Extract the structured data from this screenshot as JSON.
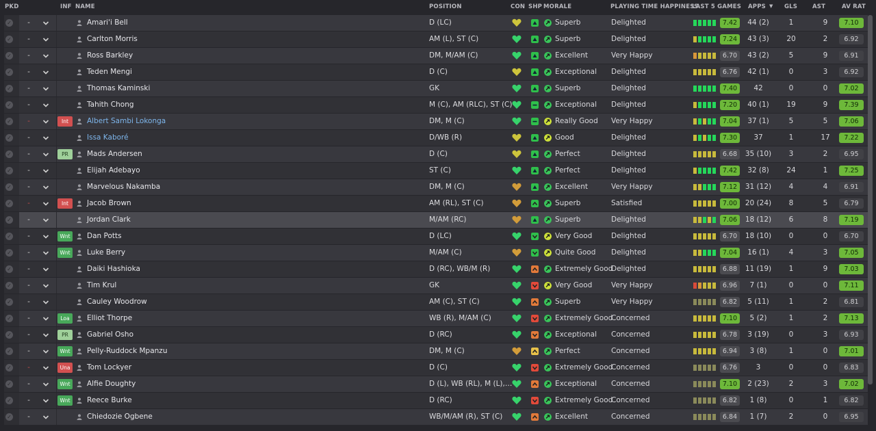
{
  "headers": {
    "pkd": "PKD",
    "inf": "INF",
    "name": "NAME",
    "position": "POSITION",
    "con": "CON",
    "shp": "SHP",
    "morale": "MORALE",
    "pth": "PLAYING TIME HAPPINESS",
    "l5": "LAST 5 GAMES",
    "apps": "APPS",
    "gls": "GLS",
    "ast": "AST",
    "avr": "AV RAT"
  },
  "colors": {
    "bar_green": "#25d85a",
    "bar_yellow": "#c8ba3c",
    "bar_orange": "#d8963a",
    "bar_red": "#d84a3a",
    "bar_grey": "#8a8a5a",
    "con_green": "#37d36b",
    "con_yellow": "#cdc43c",
    "con_orange": "#d29c3a",
    "shp_green": "#2fbf4b",
    "shp_orange": "#e27a3a",
    "shp_red": "#e24a3a",
    "shp_yellow": "#e8c24a",
    "mor_green": "#39c45a",
    "mor_yellow": "#cde03a"
  },
  "players": [
    {
      "inf": "",
      "inf_color": "",
      "name": "Amari'i Bell",
      "link": false,
      "pos": "D (LC)",
      "con": "yellow",
      "shp": "green",
      "shp_icon": "up",
      "mor_icon": "green",
      "mor": "Superb",
      "pth": "Delighted",
      "l5": [
        "g",
        "g",
        "g",
        "g",
        "g"
      ],
      "l5val": "7.42",
      "l5green": true,
      "apps": "44 (2)",
      "gls": "1",
      "ast": "9",
      "avr": "7.10",
      "avrgreen": true,
      "dash": "-",
      "dash_red": false
    },
    {
      "inf": "",
      "inf_color": "",
      "name": "Carlton Morris",
      "link": false,
      "pos": "AM (L), ST (C)",
      "con": "green",
      "shp": "green",
      "shp_icon": "up",
      "mor_icon": "green",
      "mor": "Superb",
      "pth": "Delighted",
      "l5": [
        "y",
        "g",
        "g",
        "g",
        "g"
      ],
      "l5val": "7.24",
      "l5green": true,
      "apps": "43 (3)",
      "gls": "20",
      "ast": "2",
      "avr": "6.92",
      "avrgreen": false,
      "dash": "-",
      "dash_red": false
    },
    {
      "inf": "",
      "inf_color": "",
      "name": "Ross Barkley",
      "link": false,
      "pos": "DM, M/AM (C)",
      "con": "green",
      "shp": "green",
      "shp_icon": "up",
      "mor_icon": "green",
      "mor": "Excellent",
      "pth": "Very Happy",
      "l5": [
        "o",
        "y",
        "y",
        "y",
        "y"
      ],
      "l5val": "6.70",
      "l5green": false,
      "apps": "43 (2)",
      "gls": "5",
      "ast": "9",
      "avr": "6.91",
      "avrgreen": false,
      "dash": "-",
      "dash_red": false
    },
    {
      "inf": "",
      "inf_color": "",
      "name": "Teden Mengi",
      "link": false,
      "pos": "D (C)",
      "con": "yellow",
      "shp": "green",
      "shp_icon": "up",
      "mor_icon": "green",
      "mor": "Exceptional",
      "pth": "Delighted",
      "l5": [
        "y",
        "y",
        "y",
        "y",
        "y"
      ],
      "l5val": "6.76",
      "l5green": false,
      "apps": "42 (1)",
      "gls": "0",
      "ast": "3",
      "avr": "6.92",
      "avrgreen": false,
      "dash": "-",
      "dash_red": false
    },
    {
      "inf": "",
      "inf_color": "",
      "name": "Thomas Kaminski",
      "link": false,
      "pos": "GK",
      "con": "green",
      "shp": "green",
      "shp_icon": "up",
      "mor_icon": "green",
      "mor": "Superb",
      "pth": "Delighted",
      "l5": [
        "g",
        "g",
        "g",
        "g",
        "g"
      ],
      "l5val": "7.40",
      "l5green": true,
      "apps": "42",
      "gls": "0",
      "ast": "0",
      "avr": "7.02",
      "avrgreen": true,
      "dash": "-",
      "dash_red": false
    },
    {
      "inf": "",
      "inf_color": "",
      "name": "Tahith Chong",
      "link": false,
      "pos": "M (C), AM (RLC), ST (C)",
      "con": "green",
      "shp": "green",
      "shp_icon": "flat",
      "mor_icon": "green",
      "mor": "Exceptional",
      "pth": "Delighted",
      "l5": [
        "y",
        "g",
        "g",
        "g",
        "g"
      ],
      "l5val": "7.20",
      "l5green": true,
      "apps": "40 (1)",
      "gls": "19",
      "ast": "9",
      "avr": "7.39",
      "avrgreen": true,
      "dash": "-",
      "dash_red": false
    },
    {
      "inf": "Int",
      "inf_color": "red",
      "name": "Albert Sambi Lokonga",
      "link": true,
      "pos": "DM, M (C)",
      "con": "green",
      "shp": "green",
      "shp_icon": "flat",
      "mor_icon": "yellow",
      "mor": "Really Good",
      "pth": "Very Happy",
      "l5": [
        "y",
        "g",
        "y",
        "g",
        "g"
      ],
      "l5val": "7.04",
      "l5green": true,
      "apps": "37 (1)",
      "gls": "5",
      "ast": "5",
      "avr": "7.06",
      "avrgreen": true,
      "dash": "-",
      "dash_red": true
    },
    {
      "inf": "",
      "inf_color": "",
      "name": "Issa Kaboré",
      "link": true,
      "pos": "D/WB (R)",
      "con": "yellow",
      "shp": "green",
      "shp_icon": "up",
      "mor_icon": "yellow",
      "mor": "Good",
      "pth": "Delighted",
      "l5": [
        "y",
        "g",
        "y",
        "g",
        "g"
      ],
      "l5val": "7.30",
      "l5green": true,
      "apps": "37",
      "gls": "1",
      "ast": "17",
      "avr": "7.22",
      "avrgreen": true,
      "dash": "-",
      "dash_red": false
    },
    {
      "inf": "PR",
      "inf_color": "lgreen",
      "name": "Mads Andersen",
      "link": false,
      "pos": "D (C)",
      "con": "yellow",
      "shp": "green",
      "shp_icon": "up",
      "mor_icon": "green",
      "mor": "Perfect",
      "pth": "Delighted",
      "l5": [
        "y",
        "y",
        "y",
        "y",
        "y"
      ],
      "l5val": "6.68",
      "l5green": false,
      "apps": "35 (10)",
      "gls": "3",
      "ast": "2",
      "avr": "6.95",
      "avrgreen": false,
      "dash": "-",
      "dash_red": false
    },
    {
      "inf": "",
      "inf_color": "",
      "name": "Elijah Adebayo",
      "link": false,
      "pos": "ST (C)",
      "con": "green",
      "shp": "green",
      "shp_icon": "up",
      "mor_icon": "green",
      "mor": "Perfect",
      "pth": "Delighted",
      "l5": [
        "y",
        "g",
        "g",
        "g",
        "g"
      ],
      "l5val": "7.42",
      "l5green": true,
      "apps": "32 (8)",
      "gls": "24",
      "ast": "1",
      "avr": "7.25",
      "avrgreen": true,
      "dash": "-",
      "dash_red": false
    },
    {
      "inf": "",
      "inf_color": "",
      "name": "Marvelous Nakamba",
      "link": false,
      "pos": "DM, M (C)",
      "con": "orange",
      "shp": "green",
      "shp_icon": "up",
      "mor_icon": "green",
      "mor": "Excellent",
      "pth": "Very Happy",
      "l5": [
        "y",
        "y",
        "g",
        "g",
        "g"
      ],
      "l5val": "7.12",
      "l5green": true,
      "apps": "31 (12)",
      "gls": "4",
      "ast": "4",
      "avr": "6.91",
      "avrgreen": false,
      "dash": "-",
      "dash_red": false
    },
    {
      "inf": "Int",
      "inf_color": "red",
      "name": "Jacob Brown",
      "link": false,
      "pos": "AM (RL), ST (C)",
      "con": "orange",
      "shp": "green",
      "shp_icon": "chev",
      "mor_icon": "green",
      "mor": "Superb",
      "pth": "Satisfied",
      "l5": [
        "y",
        "y",
        "y",
        "y",
        "y"
      ],
      "l5val": "7.00",
      "l5green": true,
      "apps": "20 (24)",
      "gls": "8",
      "ast": "5",
      "avr": "6.79",
      "avrgreen": false,
      "dash": "-",
      "dash_red": true
    },
    {
      "inf": "",
      "inf_color": "",
      "name": "Jordan Clark",
      "link": false,
      "pos": "M/AM (RC)",
      "con": "orange",
      "shp": "green",
      "shp_icon": "up",
      "mor_icon": "green",
      "mor": "Superb",
      "pth": "Delighted",
      "l5": [
        "y",
        "y",
        "g",
        "y",
        "g"
      ],
      "l5val": "7.06",
      "l5green": true,
      "apps": "18 (12)",
      "gls": "6",
      "ast": "8",
      "avr": "7.19",
      "avrgreen": true,
      "dash": "-",
      "dash_red": false,
      "hl": true
    },
    {
      "inf": "Wnt",
      "inf_color": "green",
      "name": "Dan Potts",
      "link": false,
      "pos": "D (LC)",
      "con": "green",
      "shp": "green",
      "shp_icon": "down",
      "mor_icon": "yellow",
      "mor": "Very Good",
      "pth": "Delighted",
      "l5": [
        "y",
        "y",
        "y",
        "y",
        "y"
      ],
      "l5val": "6.70",
      "l5green": false,
      "apps": "18 (10)",
      "gls": "0",
      "ast": "0",
      "avr": "6.70",
      "avrgreen": false,
      "dash": "-",
      "dash_red": false
    },
    {
      "inf": "Wnt",
      "inf_color": "green",
      "name": "Luke Berry",
      "link": false,
      "pos": "M/AM (C)",
      "con": "orange",
      "shp": "green",
      "shp_icon": "down",
      "mor_icon": "yellow",
      "mor": "Quite Good",
      "pth": "Delighted",
      "l5": [
        "y",
        "y",
        "g",
        "g",
        "g"
      ],
      "l5val": "7.04",
      "l5green": true,
      "apps": "16 (1)",
      "gls": "4",
      "ast": "3",
      "avr": "7.05",
      "avrgreen": true,
      "dash": "-",
      "dash_red": false
    },
    {
      "inf": "",
      "inf_color": "",
      "name": "Daiki Hashioka",
      "link": false,
      "pos": "D (RC), WB/M (R)",
      "con": "green",
      "shp": "orange",
      "shp_icon": "chev",
      "mor_icon": "green",
      "mor": "Extremely Good",
      "pth": "Delighted",
      "l5": [
        "y",
        "y",
        "y",
        "y",
        "y"
      ],
      "l5val": "6.88",
      "l5green": false,
      "apps": "11 (19)",
      "gls": "1",
      "ast": "9",
      "avr": "7.03",
      "avrgreen": true,
      "dash": "-",
      "dash_red": false
    },
    {
      "inf": "",
      "inf_color": "",
      "name": "Tim Krul",
      "link": false,
      "pos": "GK",
      "con": "green",
      "shp": "red",
      "shp_icon": "down",
      "mor_icon": "yellow",
      "mor": "Very Good",
      "pth": "Very Happy",
      "l5": [
        "r",
        "o",
        "y",
        "y",
        "y"
      ],
      "l5val": "6.96",
      "l5green": false,
      "apps": "7 (1)",
      "gls": "0",
      "ast": "0",
      "avr": "7.11",
      "avrgreen": true,
      "dash": "-",
      "dash_red": false
    },
    {
      "inf": "",
      "inf_color": "",
      "name": "Cauley Woodrow",
      "link": false,
      "pos": "AM (C), ST (C)",
      "con": "green",
      "shp": "orange",
      "shp_icon": "chev",
      "mor_icon": "green",
      "mor": "Superb",
      "pth": "Very Happy",
      "l5": [
        "n",
        "n",
        "n",
        "n",
        "n"
      ],
      "l5val": "6.82",
      "l5green": false,
      "apps": "5 (11)",
      "gls": "1",
      "ast": "2",
      "avr": "6.81",
      "avrgreen": false,
      "dash": "-",
      "dash_red": false
    },
    {
      "inf": "Loa",
      "inf_color": "green",
      "name": "Elliot Thorpe",
      "link": false,
      "pos": "WB (R), M/AM (C)",
      "con": "green",
      "shp": "red",
      "shp_icon": "down",
      "mor_icon": "green",
      "mor": "Extremely Good",
      "pth": "Concerned",
      "l5": [
        "y",
        "y",
        "y",
        "y",
        "y"
      ],
      "l5val": "7.10",
      "l5green": true,
      "apps": "5 (2)",
      "gls": "1",
      "ast": "2",
      "avr": "7.13",
      "avrgreen": true,
      "dash": "-",
      "dash_red": false
    },
    {
      "inf": "PR",
      "inf_color": "lgreen",
      "name": "Gabriel Osho",
      "link": false,
      "pos": "D (RC)",
      "con": "green",
      "shp": "orange",
      "shp_icon": "down",
      "mor_icon": "green",
      "mor": "Exceptional",
      "pth": "Concerned",
      "l5": [
        "y",
        "y",
        "y",
        "y",
        "y"
      ],
      "l5val": "6.78",
      "l5green": false,
      "apps": "3 (19)",
      "gls": "0",
      "ast": "3",
      "avr": "6.93",
      "avrgreen": false,
      "dash": "-",
      "dash_red": false
    },
    {
      "inf": "Wnt",
      "inf_color": "green",
      "name": "Pelly-Ruddock Mpanzu",
      "link": false,
      "pos": "DM, M (C)",
      "con": "orange",
      "shp": "yellow",
      "shp_icon": "chev",
      "mor_icon": "green",
      "mor": "Perfect",
      "pth": "Concerned",
      "l5": [
        "y",
        "y",
        "y",
        "y",
        "y"
      ],
      "l5val": "6.94",
      "l5green": false,
      "apps": "3 (8)",
      "gls": "1",
      "ast": "0",
      "avr": "7.01",
      "avrgreen": true,
      "dash": "-",
      "dash_red": false
    },
    {
      "inf": "Una",
      "inf_color": "red",
      "name": "Tom Lockyer",
      "link": false,
      "pos": "D (C)",
      "con": "green",
      "shp": "red",
      "shp_icon": "down",
      "mor_icon": "green",
      "mor": "Extremely Good",
      "pth": "Concerned",
      "l5": [
        "n",
        "n",
        "n",
        "n",
        "n"
      ],
      "l5val": "6.76",
      "l5green": false,
      "apps": "3",
      "gls": "0",
      "ast": "0",
      "avr": "6.83",
      "avrgreen": false,
      "dash": "-",
      "dash_red": true
    },
    {
      "inf": "Wnt",
      "inf_color": "green",
      "name": "Alfie Doughty",
      "link": false,
      "pos": "D (L), WB (RL), M (L),…",
      "con": "green",
      "shp": "orange",
      "shp_icon": "chev",
      "mor_icon": "green",
      "mor": "Exceptional",
      "pth": "Concerned",
      "l5": [
        "n",
        "n",
        "n",
        "n",
        "n"
      ],
      "l5val": "7.10",
      "l5green": true,
      "apps": "2 (23)",
      "gls": "2",
      "ast": "3",
      "avr": "7.02",
      "avrgreen": true,
      "dash": "-",
      "dash_red": false
    },
    {
      "inf": "Wnt",
      "inf_color": "green",
      "name": "Reece Burke",
      "link": false,
      "pos": "D (RC)",
      "con": "green",
      "shp": "red",
      "shp_icon": "down",
      "mor_icon": "green",
      "mor": "Extremely Good",
      "pth": "Concerned",
      "l5": [
        "n",
        "n",
        "n",
        "n",
        "n"
      ],
      "l5val": "6.82",
      "l5green": false,
      "apps": "1 (8)",
      "gls": "0",
      "ast": "1",
      "avr": "6.82",
      "avrgreen": false,
      "dash": "-",
      "dash_red": false
    },
    {
      "inf": "",
      "inf_color": "",
      "name": "Chiedozie Ogbene",
      "link": false,
      "pos": "WB/M/AM (R), ST (C)",
      "con": "green",
      "shp": "orange",
      "shp_icon": "chev",
      "mor_icon": "green",
      "mor": "Excellent",
      "pth": "Concerned",
      "l5": [
        "n",
        "n",
        "n",
        "n",
        "n"
      ],
      "l5val": "6.84",
      "l5green": false,
      "apps": "1 (7)",
      "gls": "2",
      "ast": "0",
      "avr": "6.95",
      "avrgreen": false,
      "dash": "-",
      "dash_red": false
    }
  ]
}
